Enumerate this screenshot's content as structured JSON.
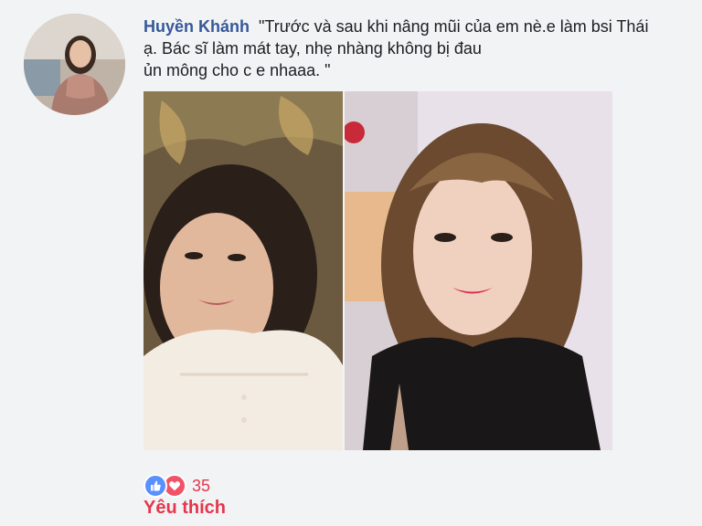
{
  "comment": {
    "author": "Huyền Khánh",
    "lines": [
      "\"Trước và sau khi nâng mũi  của em nè.e làm bsi Thái",
      "ạ. Bác sĩ làm mát tay, nhẹ nhàng không bị đau",
      "ủn mông cho c e nhaaa. \""
    ]
  },
  "reactions": {
    "icons": [
      "like-icon",
      "love-icon"
    ],
    "count": "35",
    "label": "Yêu thích"
  },
  "colors": {
    "author": "#365899",
    "reaction_text": "#e5374c",
    "like_blue": "#5890ff",
    "love_red": "#f25268"
  }
}
